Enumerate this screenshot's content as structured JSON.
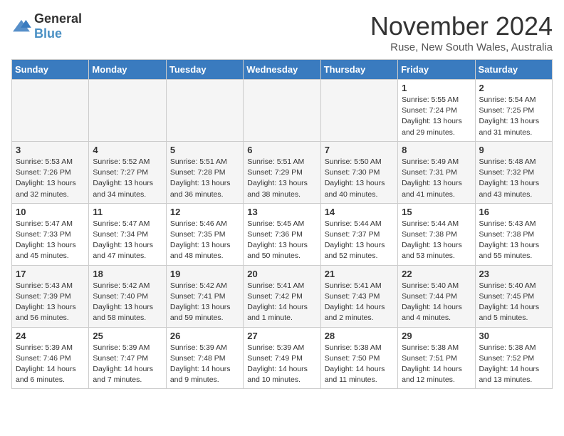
{
  "logo": {
    "general": "General",
    "blue": "Blue"
  },
  "title": "November 2024",
  "location": "Ruse, New South Wales, Australia",
  "days_of_week": [
    "Sunday",
    "Monday",
    "Tuesday",
    "Wednesday",
    "Thursday",
    "Friday",
    "Saturday"
  ],
  "weeks": [
    [
      {
        "day": "",
        "info": ""
      },
      {
        "day": "",
        "info": ""
      },
      {
        "day": "",
        "info": ""
      },
      {
        "day": "",
        "info": ""
      },
      {
        "day": "",
        "info": ""
      },
      {
        "day": "1",
        "info": "Sunrise: 5:55 AM\nSunset: 7:24 PM\nDaylight: 13 hours\nand 29 minutes."
      },
      {
        "day": "2",
        "info": "Sunrise: 5:54 AM\nSunset: 7:25 PM\nDaylight: 13 hours\nand 31 minutes."
      }
    ],
    [
      {
        "day": "3",
        "info": "Sunrise: 5:53 AM\nSunset: 7:26 PM\nDaylight: 13 hours\nand 32 minutes."
      },
      {
        "day": "4",
        "info": "Sunrise: 5:52 AM\nSunset: 7:27 PM\nDaylight: 13 hours\nand 34 minutes."
      },
      {
        "day": "5",
        "info": "Sunrise: 5:51 AM\nSunset: 7:28 PM\nDaylight: 13 hours\nand 36 minutes."
      },
      {
        "day": "6",
        "info": "Sunrise: 5:51 AM\nSunset: 7:29 PM\nDaylight: 13 hours\nand 38 minutes."
      },
      {
        "day": "7",
        "info": "Sunrise: 5:50 AM\nSunset: 7:30 PM\nDaylight: 13 hours\nand 40 minutes."
      },
      {
        "day": "8",
        "info": "Sunrise: 5:49 AM\nSunset: 7:31 PM\nDaylight: 13 hours\nand 41 minutes."
      },
      {
        "day": "9",
        "info": "Sunrise: 5:48 AM\nSunset: 7:32 PM\nDaylight: 13 hours\nand 43 minutes."
      }
    ],
    [
      {
        "day": "10",
        "info": "Sunrise: 5:47 AM\nSunset: 7:33 PM\nDaylight: 13 hours\nand 45 minutes."
      },
      {
        "day": "11",
        "info": "Sunrise: 5:47 AM\nSunset: 7:34 PM\nDaylight: 13 hours\nand 47 minutes."
      },
      {
        "day": "12",
        "info": "Sunrise: 5:46 AM\nSunset: 7:35 PM\nDaylight: 13 hours\nand 48 minutes."
      },
      {
        "day": "13",
        "info": "Sunrise: 5:45 AM\nSunset: 7:36 PM\nDaylight: 13 hours\nand 50 minutes."
      },
      {
        "day": "14",
        "info": "Sunrise: 5:44 AM\nSunset: 7:37 PM\nDaylight: 13 hours\nand 52 minutes."
      },
      {
        "day": "15",
        "info": "Sunrise: 5:44 AM\nSunset: 7:38 PM\nDaylight: 13 hours\nand 53 minutes."
      },
      {
        "day": "16",
        "info": "Sunrise: 5:43 AM\nSunset: 7:38 PM\nDaylight: 13 hours\nand 55 minutes."
      }
    ],
    [
      {
        "day": "17",
        "info": "Sunrise: 5:43 AM\nSunset: 7:39 PM\nDaylight: 13 hours\nand 56 minutes."
      },
      {
        "day": "18",
        "info": "Sunrise: 5:42 AM\nSunset: 7:40 PM\nDaylight: 13 hours\nand 58 minutes."
      },
      {
        "day": "19",
        "info": "Sunrise: 5:42 AM\nSunset: 7:41 PM\nDaylight: 13 hours\nand 59 minutes."
      },
      {
        "day": "20",
        "info": "Sunrise: 5:41 AM\nSunset: 7:42 PM\nDaylight: 14 hours\nand 1 minute."
      },
      {
        "day": "21",
        "info": "Sunrise: 5:41 AM\nSunset: 7:43 PM\nDaylight: 14 hours\nand 2 minutes."
      },
      {
        "day": "22",
        "info": "Sunrise: 5:40 AM\nSunset: 7:44 PM\nDaylight: 14 hours\nand 4 minutes."
      },
      {
        "day": "23",
        "info": "Sunrise: 5:40 AM\nSunset: 7:45 PM\nDaylight: 14 hours\nand 5 minutes."
      }
    ],
    [
      {
        "day": "24",
        "info": "Sunrise: 5:39 AM\nSunset: 7:46 PM\nDaylight: 14 hours\nand 6 minutes."
      },
      {
        "day": "25",
        "info": "Sunrise: 5:39 AM\nSunset: 7:47 PM\nDaylight: 14 hours\nand 7 minutes."
      },
      {
        "day": "26",
        "info": "Sunrise: 5:39 AM\nSunset: 7:48 PM\nDaylight: 14 hours\nand 9 minutes."
      },
      {
        "day": "27",
        "info": "Sunrise: 5:39 AM\nSunset: 7:49 PM\nDaylight: 14 hours\nand 10 minutes."
      },
      {
        "day": "28",
        "info": "Sunrise: 5:38 AM\nSunset: 7:50 PM\nDaylight: 14 hours\nand 11 minutes."
      },
      {
        "day": "29",
        "info": "Sunrise: 5:38 AM\nSunset: 7:51 PM\nDaylight: 14 hours\nand 12 minutes."
      },
      {
        "day": "30",
        "info": "Sunrise: 5:38 AM\nSunset: 7:52 PM\nDaylight: 14 hours\nand 13 minutes."
      }
    ]
  ]
}
